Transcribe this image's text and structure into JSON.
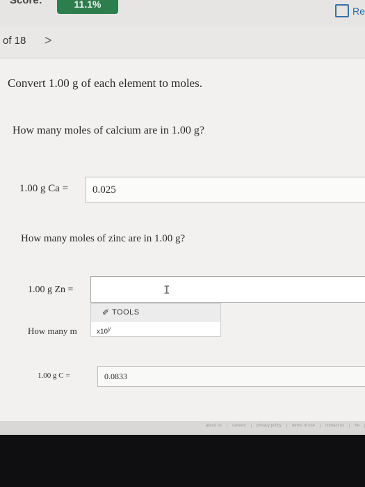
{
  "header": {
    "score_label": "Score:",
    "score_value": "11.1%",
    "resources_label": "Re"
  },
  "nav": {
    "count": "of 18",
    "next_glyph": ">"
  },
  "question": {
    "title": "Convert 1.00 g of each element to moles.",
    "part1": {
      "prompt": "How many moles of calcium are in 1.00 g?",
      "label": "1.00 g Ca =",
      "value": "0.025"
    },
    "part2": {
      "prompt": "How many moles of zinc are in 1.00 g?",
      "label": "1.00 g Zn =",
      "value": ""
    },
    "tools": {
      "label": "TOOLS",
      "sci_notation": "x10",
      "sci_exponent": "y"
    },
    "part3": {
      "prompt_visible": "How many m",
      "label": "1.00 g C =",
      "value": "0.0833"
    }
  },
  "footer": {
    "links": [
      "about us",
      "careers",
      "privacy policy",
      "terms of use",
      "contact us",
      "he"
    ]
  }
}
